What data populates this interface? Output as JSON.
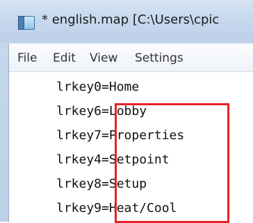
{
  "window": {
    "title": "* english.map [C:\\Users\\cpic"
  },
  "menu": {
    "items": [
      "File",
      "Edit",
      "View",
      "Settings"
    ]
  },
  "editor": {
    "lines": [
      "lrkey0=Home",
      "lrkey6=Lobby",
      "lrkey7=Properties",
      "lrkey4=Setpoint",
      "lrkey8=Setup",
      "lrkey9=Heat/Cool"
    ]
  },
  "annotation": {
    "color": "#e62129"
  }
}
